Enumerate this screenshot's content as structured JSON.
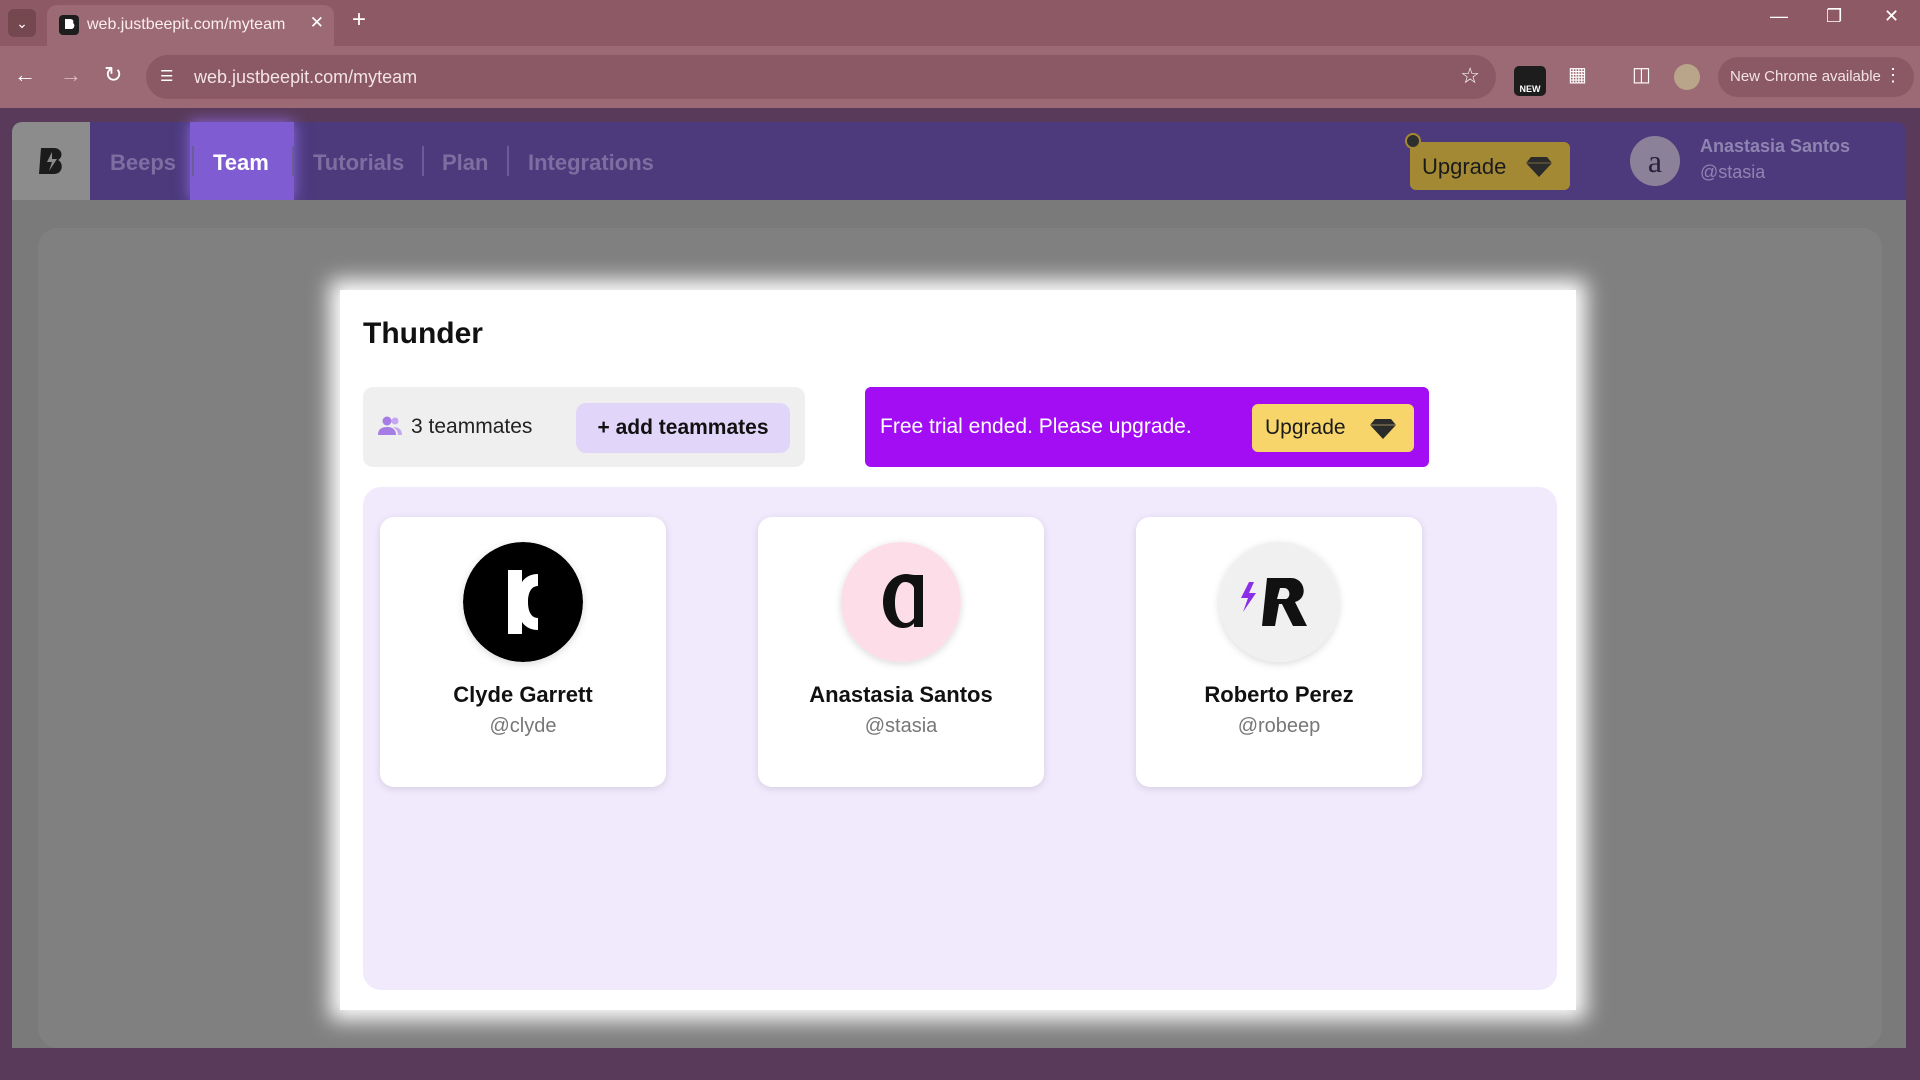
{
  "browser": {
    "tab_title": "web.justbeepit.com/myteam",
    "url": "web.justbeepit.com/myteam",
    "new_badge": "NEW",
    "update_label": "New Chrome available"
  },
  "nav": {
    "links": [
      "Beeps",
      "Team",
      "Tutorials",
      "Plan",
      "Integrations"
    ],
    "active": "Team",
    "upgrade_label": "Upgrade",
    "user_name": "Anastasia Santos",
    "user_handle": "@stasia",
    "user_initial": "a"
  },
  "team": {
    "name": "Thunder",
    "teammates_count": "3 teammates",
    "add_label": "+ add teammates",
    "trial_text": "Free trial ended. Please upgrade.",
    "upgrade_label": "Upgrade"
  },
  "members": [
    {
      "name": "Clyde Garrett",
      "handle": "@clyde"
    },
    {
      "name": "Anastasia Santos",
      "handle": "@stasia"
    },
    {
      "name": "Roberto Perez",
      "handle": "@robeep"
    }
  ],
  "colors": {
    "nav_bg": "#4c3a7c",
    "accent_purple": "#a30df3",
    "upgrade_yellow": "#f7d56a",
    "members_bg": "#f1eafd"
  }
}
